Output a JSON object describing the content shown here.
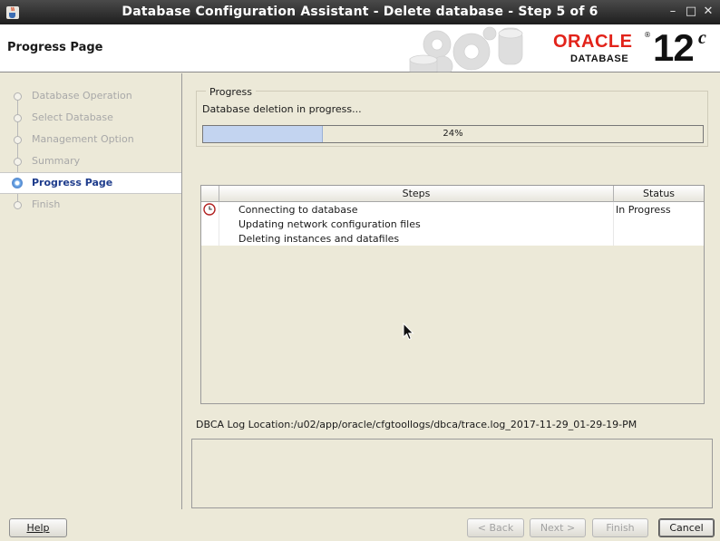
{
  "window": {
    "title": "Database Configuration Assistant - Delete database - Step 5 of 6",
    "controls": {
      "minimize": "–",
      "maximize": "□",
      "close": "✕"
    }
  },
  "header": {
    "page_title": "Progress Page",
    "brand": {
      "oracle": "ORACLE",
      "registered": "®",
      "product": "DATABASE",
      "version": "12",
      "version_suffix": "c"
    }
  },
  "nav": {
    "items": [
      {
        "label": "Database Operation",
        "state": "done"
      },
      {
        "label": "Select Database",
        "state": "done"
      },
      {
        "label": "Management Option",
        "state": "done"
      },
      {
        "label": "Summary",
        "state": "done"
      },
      {
        "label": "Progress Page",
        "state": "active"
      },
      {
        "label": "Finish",
        "state": "pending"
      }
    ]
  },
  "progress": {
    "group_label": "Progress",
    "message": "Database deletion in progress...",
    "value": 0.24,
    "percent_text": "24%"
  },
  "steps_table": {
    "headers": {
      "icon": "",
      "steps": "Steps",
      "status": "Status"
    },
    "rows": [
      {
        "icon": "clock-icon",
        "step": "Connecting to database",
        "status": "In Progress"
      },
      {
        "icon": "",
        "step": "Updating network configuration files",
        "status": ""
      },
      {
        "icon": "",
        "step": "Deleting instances and datafiles",
        "status": ""
      }
    ]
  },
  "log": {
    "location": "DBCA Log Location:/u02/app/oracle/cfgtoollogs/dbca/trace.log_2017-11-29_01-29-19-PM"
  },
  "buttons": {
    "help": "Help",
    "back": "< Back",
    "next": "Next >",
    "finish": "Finish",
    "cancel": "Cancel"
  },
  "colors": {
    "oracle_red": "#e2231a",
    "progress_fill": "#c3d4f0",
    "active_nav_text": "#1e3c8c"
  }
}
